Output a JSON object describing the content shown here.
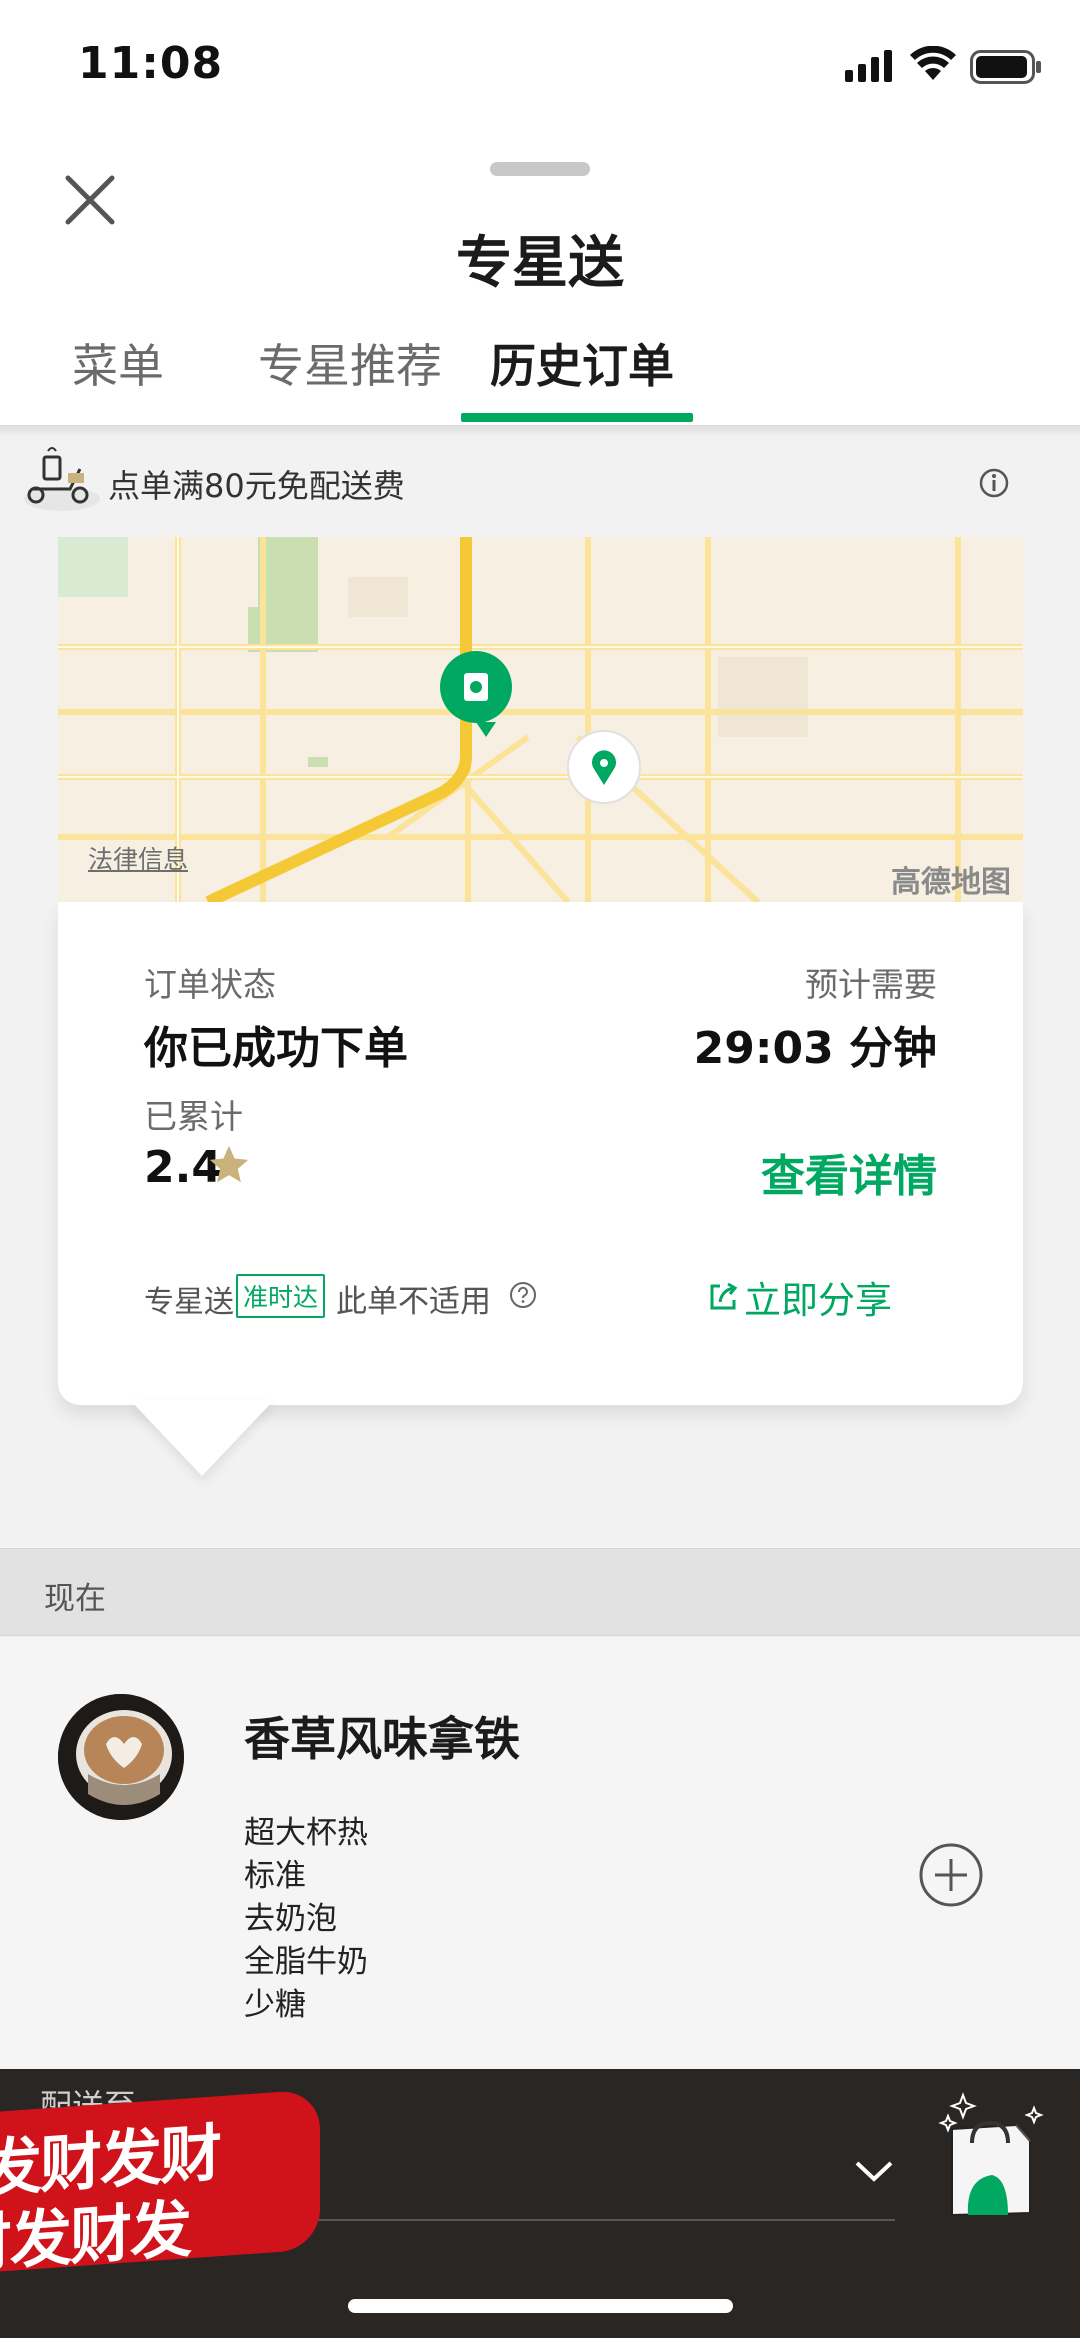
{
  "status_bar": {
    "time": "11:08"
  },
  "header": {
    "title": "专星送",
    "tabs": [
      {
        "label": "菜单"
      },
      {
        "label": "专星推荐"
      },
      {
        "label": "历史订单"
      }
    ],
    "active_tab": "历史订单"
  },
  "promo": {
    "text": "点单满80元免配送费"
  },
  "map": {
    "legal_link": "法律信息",
    "provider": "高德地图"
  },
  "order": {
    "status_label": "订单状态",
    "status_value": "你已成功下单",
    "eta_label": "预计需要",
    "eta_value": "29:03 分钟",
    "accumulated_label": "已累计",
    "accumulated_value": "2.4",
    "details_button": "查看详情",
    "brand_mini": "专星送",
    "ontime_badge": "准时达",
    "not_applicable": "此单不适用",
    "share_button": "立即分享"
  },
  "section": {
    "label": "现在"
  },
  "product": {
    "name": "香草风味拿铁",
    "options": [
      "超大杯热",
      "标准",
      "去奶泡",
      "全脂牛奶",
      "少糖"
    ]
  },
  "bottom_bar": {
    "delivery_label": "配送至",
    "watermark_lines": [
      "发财发财",
      "财发财发"
    ]
  },
  "colors": {
    "accent": "#00a862",
    "star": "#c9b27c",
    "bottom_bar": "#292624"
  }
}
